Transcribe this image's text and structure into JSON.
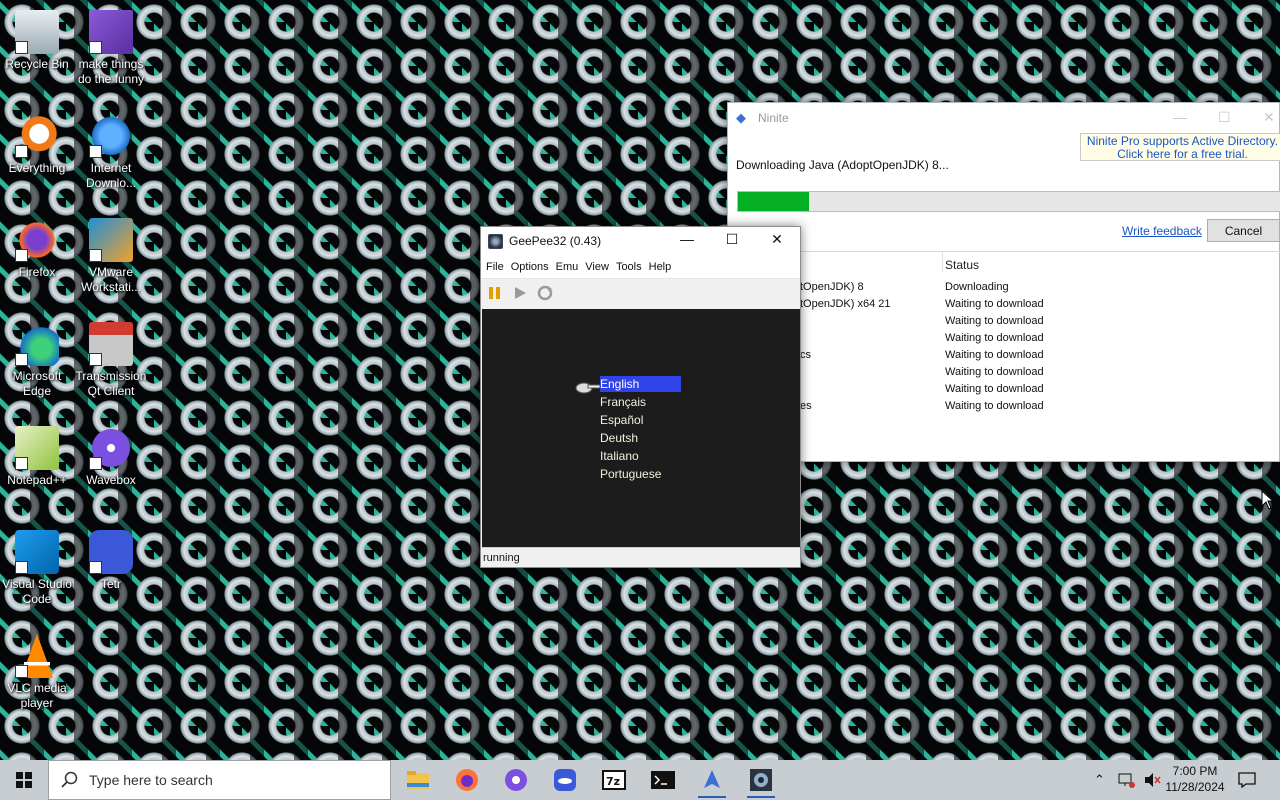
{
  "desktop_icons": [
    {
      "label": "Recycle Bin"
    },
    {
      "label": "make things do the funny"
    },
    {
      "label": "Everything"
    },
    {
      "label": "Internet Downlo..."
    },
    {
      "label": "Firefox"
    },
    {
      "label": "VMware Workstati..."
    },
    {
      "label": "Microsoft Edge"
    },
    {
      "label": "Transmission Qt Client"
    },
    {
      "label": "Notepad++"
    },
    {
      "label": "Wavebox"
    },
    {
      "label": "Visual Studio Code"
    },
    {
      "label": "Tetr"
    },
    {
      "label": "VLC media player"
    }
  ],
  "ninite": {
    "title": "Ninite",
    "ad_line1": "Ninite Pro supports Active Directory.",
    "ad_line2": "Click here for a free trial.",
    "downloading": "Downloading Java (AdoptOpenJDK) 8...",
    "progress": 0.13,
    "write_feedback": "Write feedback",
    "cancel": "Cancel",
    "status_header": "Status",
    "rows": [
      {
        "name": "tOpenJDK) 8",
        "status": "Downloading"
      },
      {
        "name": "tOpenJDK) x64 21",
        "status": "Waiting to download"
      },
      {
        "name": "",
        "status": "Waiting to download"
      },
      {
        "name": "",
        "status": "Waiting to download"
      },
      {
        "name": "cs",
        "status": "Waiting to download"
      },
      {
        "name": "",
        "status": "Waiting to download"
      },
      {
        "name": "",
        "status": "Waiting to download"
      },
      {
        "name": "es",
        "status": "Waiting to download"
      }
    ]
  },
  "geepee": {
    "title": "GeePee32 (0.43)",
    "menu": [
      "File",
      "Options",
      "Emu",
      "View",
      "Tools",
      "Help"
    ],
    "languages": [
      "English",
      "Français",
      "Español",
      "Deutsh",
      "Italiano",
      "Portuguese"
    ],
    "selected_language": "English",
    "status": "running"
  },
  "taskbar": {
    "search_placeholder": "Type here to search",
    "time": "7:00 PM",
    "date": "11/28/2024"
  }
}
